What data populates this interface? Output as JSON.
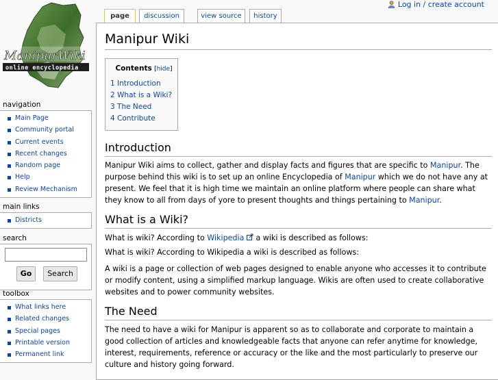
{
  "logo": {
    "line1": "ManipurWiki",
    "line2": "online encyclopedia"
  },
  "user": {
    "login_label": "Log in / create account"
  },
  "tabs": [
    {
      "label": "page",
      "selected": true
    },
    {
      "label": "discussion"
    },
    {
      "label": "view source"
    },
    {
      "label": "history"
    }
  ],
  "page_title": "Manipur Wiki",
  "toc": {
    "title": "Contents",
    "hide": "hide",
    "items": [
      {
        "num": "1",
        "label": "Introduction"
      },
      {
        "num": "2",
        "label": "What is a Wiki?"
      },
      {
        "num": "3",
        "label": "The Need"
      },
      {
        "num": "4",
        "label": "Contribute"
      }
    ]
  },
  "sections": {
    "intro": {
      "heading": "Introduction",
      "t1": "Manipur Wiki aims to collect, gather and display facts and figures that are specific to ",
      "l1": "Manipur",
      "t2": ". The purpose behind this wiki is to set up an online Encyclopedia of ",
      "l2": "Manipur",
      "t3": " which we do not have any at present. We feel that it is high time we maintain an online platform where people can share what they know to all from days of yore to present thoughts and things pertaining to ",
      "l3": "Manipur",
      "t4": "."
    },
    "wiki": {
      "heading": "What is a Wiki?",
      "p1a": "What is wiki? According to ",
      "p1link": "Wikipedia",
      "p1b": " a wiki is described as follows:",
      "p2": "What is wiki? According to Wikipedia a wiki is described as follows:",
      "p3": "A wiki is a page or collection of web pages designed to enable anyone who accesses it to contribute or modify content, using a simplified markup language. Wikis are often used to create collaborative websites and to power community websites."
    },
    "need": {
      "heading": "The Need",
      "p1": "The need to have a wiki for Manipur is apparent so as to collaborate and corporate to maintain a good collection of articles and knowledgeable facts that anyone can refer anytime for knowledge, interest, requirements, reference or accuracy or the like and the most particularly to preserve our culture and history going forward."
    }
  },
  "sidebar": {
    "navigation": {
      "title": "navigation",
      "items": [
        "Main Page",
        "Community portal",
        "Current events",
        "Recent changes",
        "Random page",
        "Help",
        "Review Mechanism"
      ]
    },
    "main_links": {
      "title": "main links",
      "items": [
        "Districts"
      ]
    },
    "search": {
      "title": "search",
      "value": "",
      "go_label": "Go",
      "search_label": "Search"
    },
    "toolbox": {
      "title": "toolbox",
      "items": [
        "What links here",
        "Related changes",
        "Special pages",
        "Printable version",
        "Permanent link"
      ]
    }
  }
}
